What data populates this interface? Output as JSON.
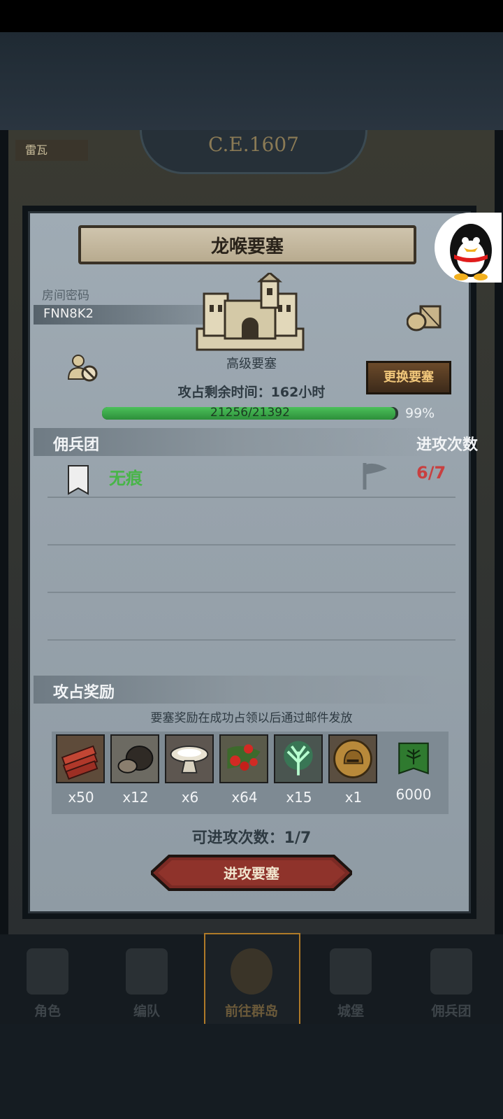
{
  "background": {
    "era": "C.E.1607",
    "left_label": "雷瓦"
  },
  "dialog": {
    "title": "龙喉要塞",
    "room_label": "房间密码",
    "room_code": "FNN8K2",
    "fortress_type": "高级要塞",
    "change_button": "更换要塞",
    "time_remaining": "攻占剩余时间：162小时",
    "hp_text": "21256/21392",
    "hp_percent_text": "99%",
    "hp_fraction": 0.99
  },
  "mercenaries": {
    "header": "佣兵团",
    "attacks_header": "进攻次数",
    "rows": [
      {
        "name": "无痕",
        "attacks": "6/7"
      }
    ]
  },
  "rewards": {
    "header": "攻占奖励",
    "note": "要塞奖励在成功占领以后通过邮件发放",
    "items": [
      {
        "icon": "timber-icon",
        "count": "x50"
      },
      {
        "icon": "ore-icon",
        "count": "x12"
      },
      {
        "icon": "salt-dish-icon",
        "count": "x6"
      },
      {
        "icon": "berries-icon",
        "count": "x64"
      },
      {
        "icon": "herb-icon",
        "count": "x15"
      },
      {
        "icon": "helmet-medal-icon",
        "count": "x1"
      },
      {
        "icon": "banner-icon",
        "count": "6000"
      }
    ]
  },
  "attack_remaining": "可进攻次数：1/7",
  "attack_button": "进攻要塞",
  "nav": [
    {
      "label": "角色"
    },
    {
      "label": "编队"
    },
    {
      "label": "前往群岛"
    },
    {
      "label": "城堡"
    },
    {
      "label": "佣兵团"
    }
  ]
}
